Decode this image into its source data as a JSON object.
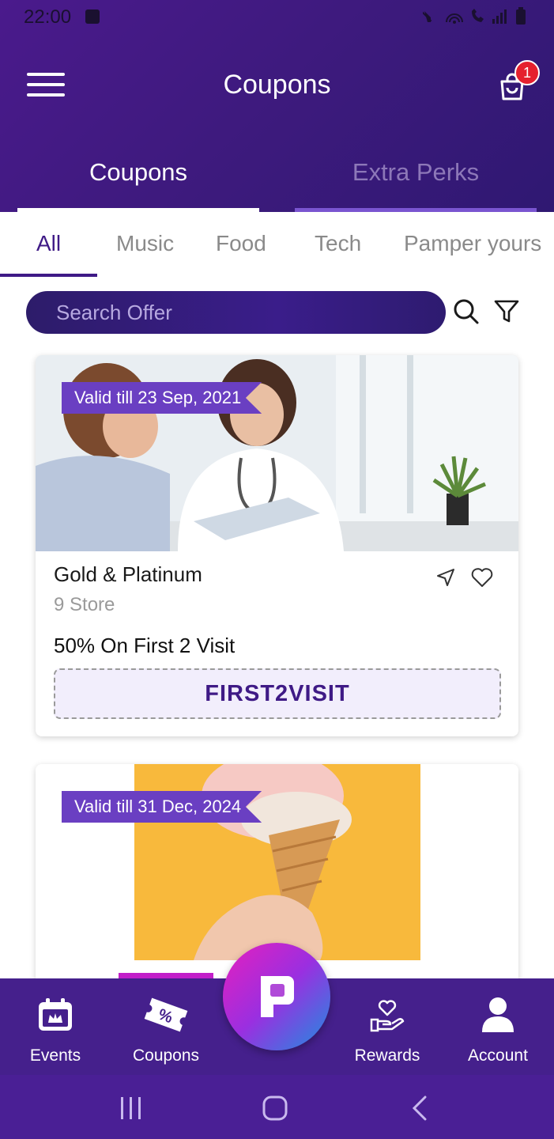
{
  "status_bar": {
    "time": "22:00"
  },
  "header": {
    "title": "Coupons",
    "cart_badge": "1",
    "tabs": [
      {
        "label": "Coupons",
        "active": true
      },
      {
        "label": "Extra Perks",
        "active": false
      }
    ]
  },
  "categories": {
    "items": [
      "All",
      "Music",
      "Food",
      "Tech",
      "Pamper yours"
    ],
    "selected": "All"
  },
  "search": {
    "placeholder": "Search Offer"
  },
  "offers": [
    {
      "valid_label": "Valid till 23 Sep, 2021",
      "title": "Gold & Platinum",
      "stores": "9 Store",
      "offer_text": "50% On First 2 Visit",
      "code": "FIRST2VISIT"
    },
    {
      "valid_label": "Valid till 31 Dec, 2024"
    }
  ],
  "bottom_nav": {
    "items": [
      {
        "label": "Events"
      },
      {
        "label": "Coupons"
      },
      {
        "label": "Rewards"
      },
      {
        "label": "Account"
      }
    ]
  },
  "colors": {
    "primary": "#45208c",
    "accent": "#6a3fc2",
    "badge": "#e5202e",
    "code_text": "#3f1a86"
  }
}
